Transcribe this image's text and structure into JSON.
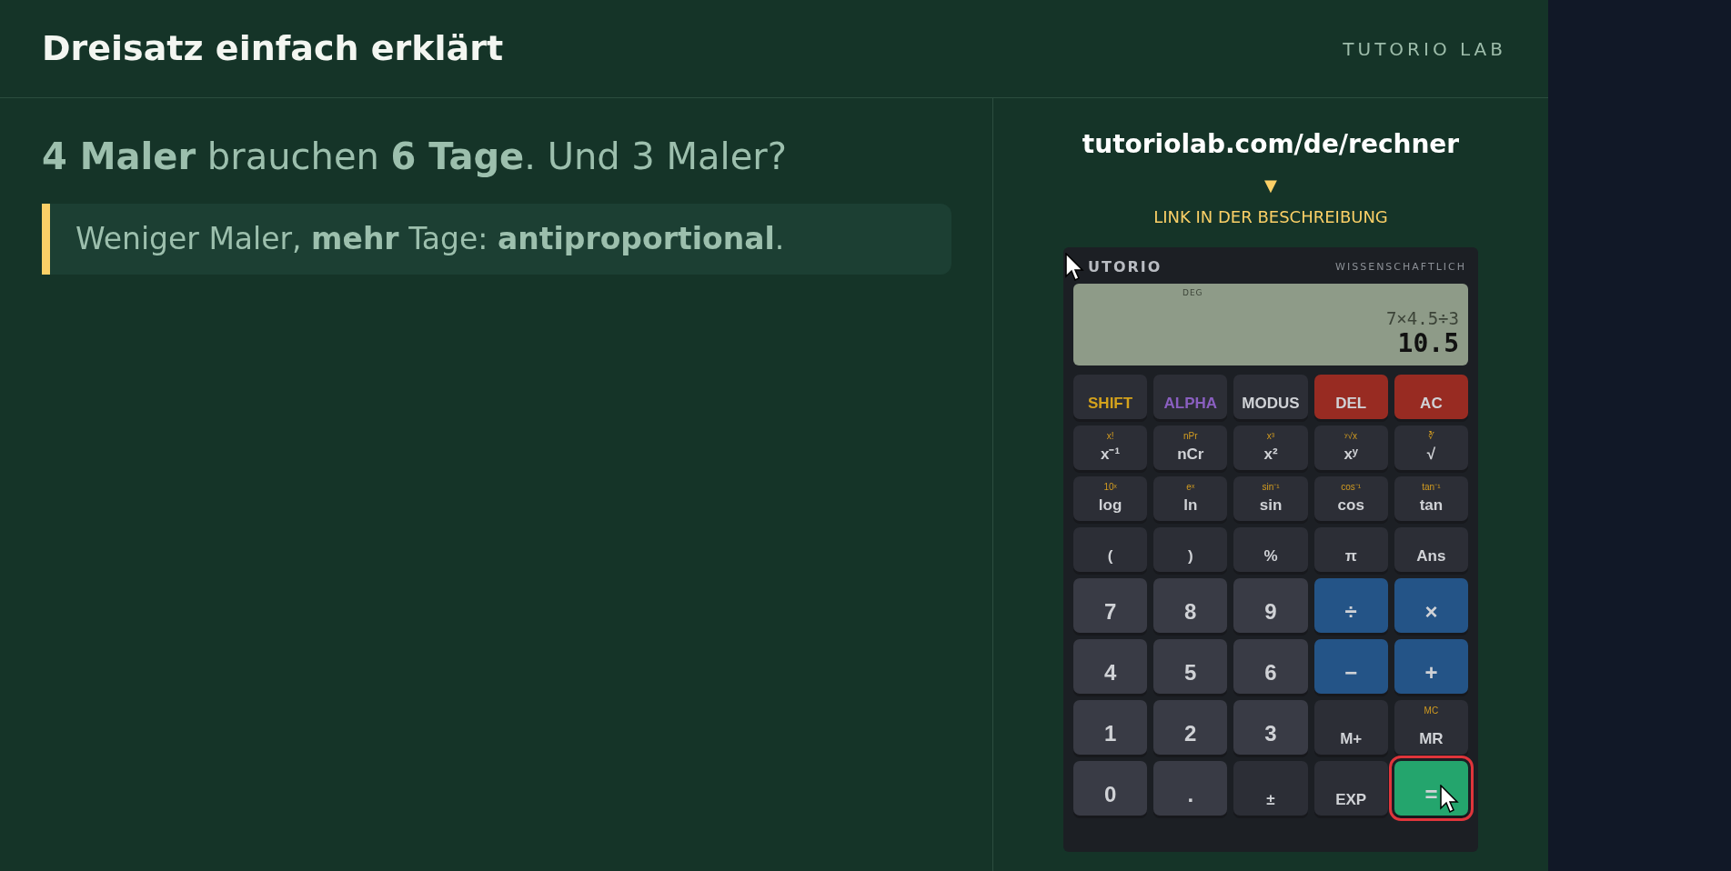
{
  "header": {
    "title": "Dreisatz einfach erklärt",
    "brand": "TUTORIO LAB"
  },
  "question": "**4 Maler** brauchen **6 Tage**. Und 3 Maler?",
  "callout": "Weniger Maler, **mehr** Tage: **antiproportional**.",
  "promo": {
    "url": "tutoriolab.com/de/rechner",
    "arrow": "▼",
    "caption": "LINK IN DER BESCHREIBUNG"
  },
  "calculator": {
    "brand": "UTORIO",
    "model": "WISSENSCHAFTLICH",
    "display": {
      "mode": "DEG",
      "expression": "7×4.5÷3",
      "result": "10.5"
    },
    "keys": [
      {
        "label": "SHIFT",
        "kind": "shift",
        "highlighted": false
      },
      {
        "label": "ALPHA",
        "kind": "alpha",
        "highlighted": false
      },
      {
        "label": "MODUS",
        "kind": "func",
        "highlighted": false
      },
      {
        "label": "DEL",
        "kind": "danger",
        "highlighted": false
      },
      {
        "label": "AC",
        "kind": "danger",
        "highlighted": false
      },
      {
        "label": "x⁻¹",
        "secondary": "x!",
        "kind": "func",
        "highlighted": false
      },
      {
        "label": "nCr",
        "secondary": "nPr",
        "kind": "func",
        "highlighted": false
      },
      {
        "label": "x²",
        "secondary": "x³",
        "kind": "func",
        "highlighted": false
      },
      {
        "label": "xʸ",
        "secondary": "ʸ√x",
        "kind": "func",
        "highlighted": false
      },
      {
        "label": "√",
        "secondary": "∛",
        "kind": "func",
        "highlighted": false
      },
      {
        "label": "log",
        "secondary": "10ˣ",
        "kind": "func",
        "highlighted": false
      },
      {
        "label": "ln",
        "secondary": "eˣ",
        "kind": "func",
        "highlighted": false
      },
      {
        "label": "sin",
        "secondary": "sin⁻¹",
        "kind": "func",
        "highlighted": false
      },
      {
        "label": "cos",
        "secondary": "cos⁻¹",
        "kind": "func",
        "highlighted": false
      },
      {
        "label": "tan",
        "secondary": "tan⁻¹",
        "kind": "func",
        "highlighted": false
      },
      {
        "label": "(",
        "kind": "func",
        "highlighted": false
      },
      {
        "label": ")",
        "kind": "func",
        "highlighted": false
      },
      {
        "label": "%",
        "kind": "func",
        "highlighted": false
      },
      {
        "label": "π",
        "kind": "func",
        "highlighted": false
      },
      {
        "label": "Ans",
        "kind": "func",
        "highlighted": false
      },
      {
        "label": "7",
        "kind": "num",
        "highlighted": false
      },
      {
        "label": "8",
        "kind": "num",
        "highlighted": false
      },
      {
        "label": "9",
        "kind": "num",
        "highlighted": false
      },
      {
        "label": "÷",
        "kind": "op",
        "highlighted": false
      },
      {
        "label": "×",
        "kind": "op",
        "highlighted": false
      },
      {
        "label": "4",
        "kind": "num",
        "highlighted": false
      },
      {
        "label": "5",
        "kind": "num",
        "highlighted": false
      },
      {
        "label": "6",
        "kind": "num",
        "highlighted": false
      },
      {
        "label": "−",
        "kind": "op",
        "highlighted": false
      },
      {
        "label": "+",
        "kind": "op",
        "highlighted": false
      },
      {
        "label": "1",
        "kind": "num",
        "highlighted": false
      },
      {
        "label": "2",
        "kind": "num",
        "highlighted": false
      },
      {
        "label": "3",
        "kind": "num",
        "highlighted": false
      },
      {
        "label": "M+",
        "kind": "func",
        "highlighted": false
      },
      {
        "label": "MR",
        "secondary": "MC",
        "kind": "func",
        "highlighted": false
      },
      {
        "label": "0",
        "kind": "num",
        "highlighted": false
      },
      {
        "label": ".",
        "kind": "num",
        "highlighted": false
      },
      {
        "label": "±",
        "kind": "func",
        "highlighted": false
      },
      {
        "label": "EXP",
        "kind": "func",
        "highlighted": false
      },
      {
        "label": "=",
        "kind": "equals",
        "highlighted": true
      }
    ]
  }
}
